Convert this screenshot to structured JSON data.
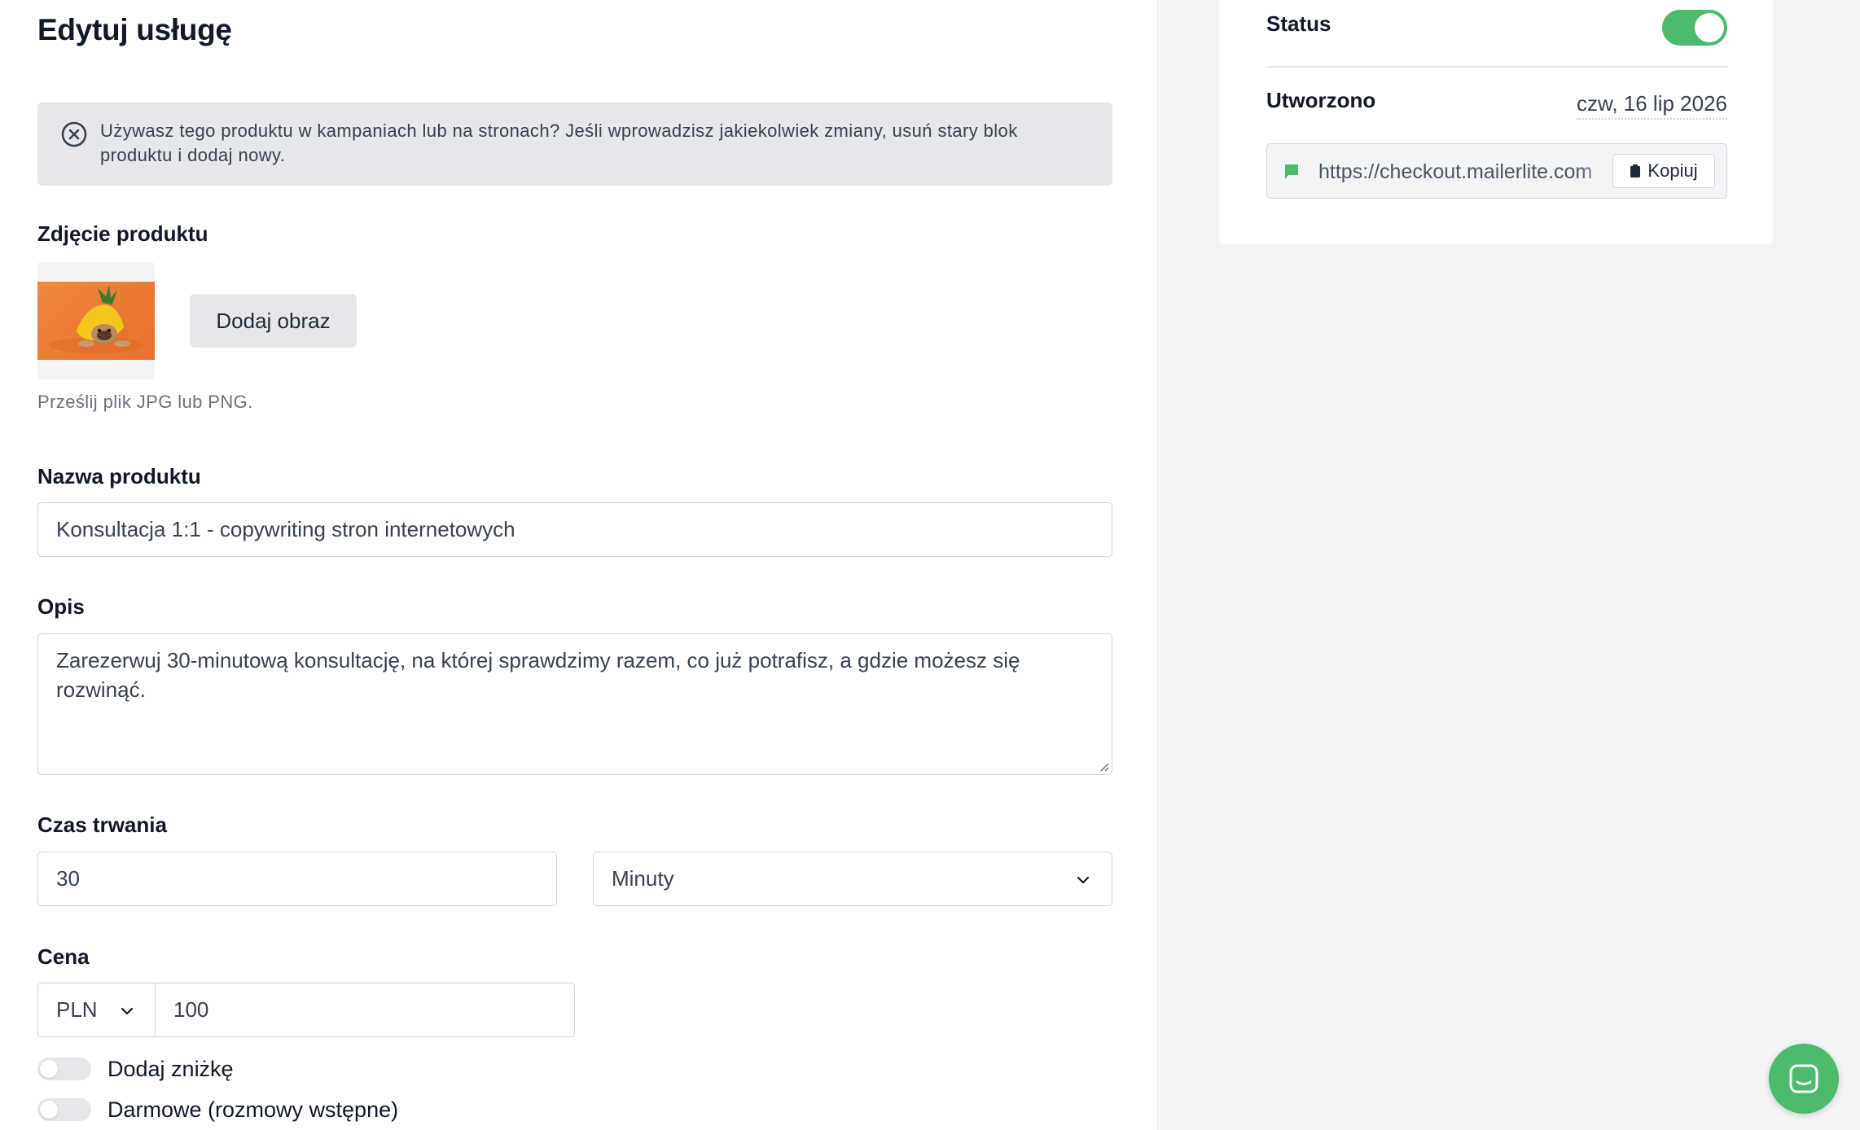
{
  "page": {
    "title": "Edytuj usługę"
  },
  "alert": {
    "icon": "x-circle-icon",
    "text": "Używasz tego produktu w kampaniach lub na stronach? Jeśli wprowadzisz jakiekolwiek zmiany, usuń stary blok produktu i dodaj nowy."
  },
  "image_section": {
    "label": "Zdjęcie produktu",
    "add_button": "Dodaj obraz",
    "hint": "Prześlij plik JPG lub PNG."
  },
  "name_section": {
    "label": "Nazwa produktu",
    "value": "Konsultacja 1:1 - copywriting stron internetowych"
  },
  "description_section": {
    "label": "Opis",
    "value": "Zarezerwuj 30-minutową konsultację, na której sprawdzimy razem, co już potrafisz, a gdzie możesz się rozwinąć."
  },
  "duration_section": {
    "label": "Czas trwania",
    "value": "30",
    "unit": "Minuty"
  },
  "price_section": {
    "label": "Cena",
    "currency": "PLN",
    "value": "100"
  },
  "toggles": {
    "discount_label": "Dodaj zniżkę",
    "discount_on": false,
    "free_label": "Darmowe (rozmowy wstępne)",
    "free_on": false
  },
  "sidebar": {
    "status_label": "Status",
    "status_on": true,
    "created_label": "Utworzono",
    "created_value": "czw, 16 lip 2026",
    "url": "https://checkout.mailerlite.com",
    "copy_button": "Kopiuj"
  },
  "colors": {
    "accent_green": "#4cbb6c",
    "alert_bg": "#e5e7eb",
    "right_panel_bg": "#f3f4f6"
  },
  "chat": {
    "icon": "chat-icon"
  }
}
